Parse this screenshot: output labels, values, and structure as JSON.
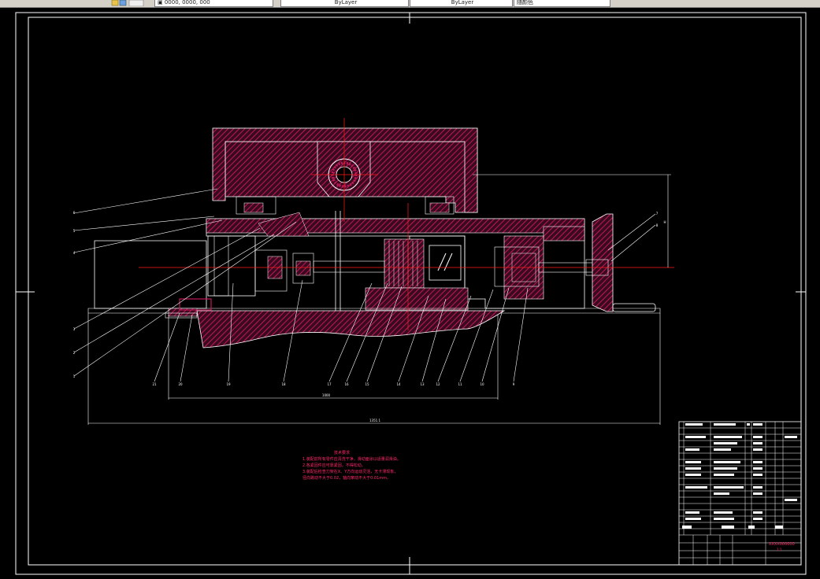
{
  "toolbar": {
    "fields": [
      {
        "name": "layer-field",
        "value": "▣ 0000, 0000, 000"
      },
      {
        "name": "linetype-field",
        "value": "ByLayer"
      },
      {
        "name": "lineweight-field",
        "value": "ByLayer"
      },
      {
        "name": "plotstyle-field",
        "value": "随颜色"
      }
    ]
  },
  "drawing": {
    "part_labels_left": [
      "6",
      "5",
      "4",
      "3",
      "2",
      "1"
    ],
    "part_labels_right": [
      "7",
      "8"
    ],
    "part_labels_bottom": [
      "21",
      "20",
      "19",
      "18",
      "17",
      "16",
      "15",
      "14",
      "13",
      "12",
      "11",
      "10",
      "9"
    ],
    "dim_upper": "1000",
    "dim_lower": "1351.1",
    "dim_right": "H"
  },
  "notes": {
    "title": "技术要求",
    "lines": [
      "1.装配前所有零件应清洗干净，滑动面涂以适量润滑油。",
      "2.各紧固件应可靠紧固，不得松动。",
      "3.装配后检查刀架在X、Y方向运动灵活，无卡滞现象，",
      "   径向跳动不大于0.02，轴向窜动不大于0.01mm。"
    ]
  },
  "title_block": {
    "drawing_no": "XXXX000000",
    "scale_text": "1:1"
  },
  "colors": {
    "outline": "#ffffff",
    "hatch": "#c0185a",
    "centerline": "#ff1a1a",
    "dimension": "#ffffff",
    "notes": "#ff2a6a"
  }
}
